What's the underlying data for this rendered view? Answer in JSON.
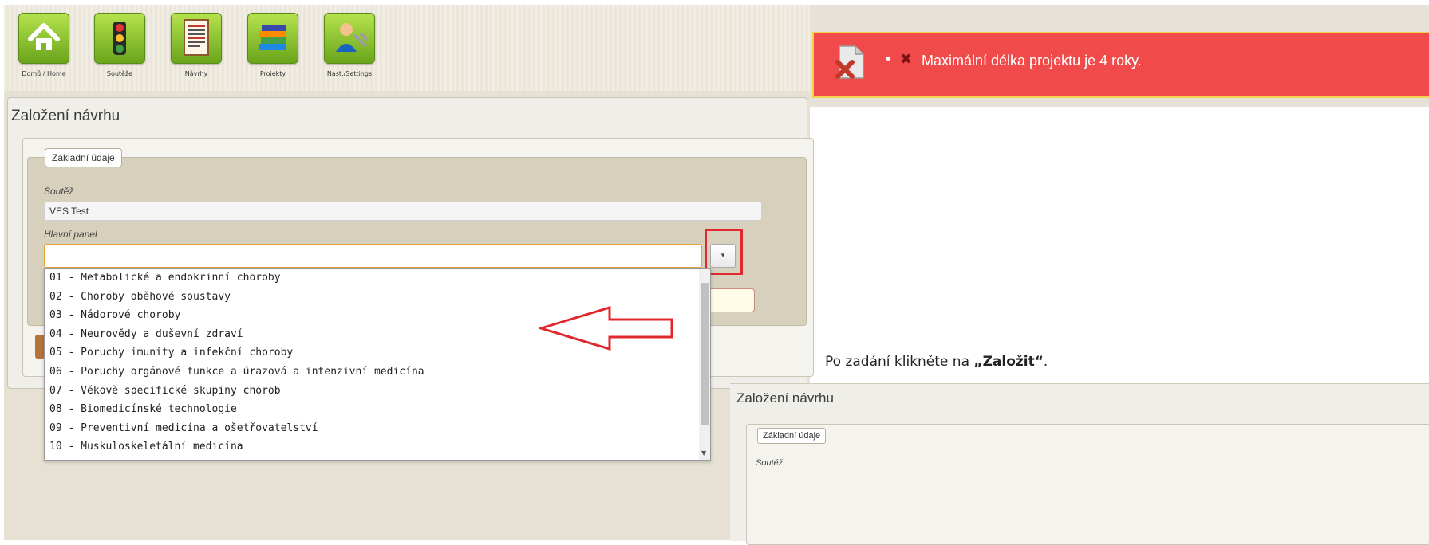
{
  "nav": {
    "items": [
      {
        "label": "Domů / Home",
        "icon": "home-icon"
      },
      {
        "label": "Soutěže",
        "icon": "traffic-light-icon"
      },
      {
        "label": "Návrhy",
        "icon": "document-icon"
      },
      {
        "label": "Projekty",
        "icon": "books-icon"
      },
      {
        "label": "Nast./Settings",
        "icon": "user-wrench-icon"
      }
    ]
  },
  "form": {
    "title": "Založení návrhu",
    "legend": "Základní údaje",
    "competition_label": "Soutěž",
    "competition_value": "VES Test",
    "panel_label": "Hlavní panel",
    "panel_value": ""
  },
  "dropdown": {
    "options": [
      "01 - Metabolické a endokrinní choroby",
      "02 - Choroby oběhové soustavy",
      "03 - Nádorové choroby",
      "04 - Neurovědy a duševní zdraví",
      "05 - Poruchy imunity a infekční choroby",
      "06 - Poruchy orgánové funkce a úrazová a intenzivní medicína",
      "07 - Věkově specifické skupiny chorob",
      "08 - Biomedicínské technologie",
      "09 - Preventivní medicína a ošetřovatelství",
      "10 - Muskuloskeletální medicína"
    ]
  },
  "error_banner": {
    "bullet": "•",
    "message": "Maximální délka projektu je 4 roky.",
    "color": "#f04a4a"
  },
  "instruction": {
    "prefix": "Po zadání klikněte na ",
    "bold": "„Založit“",
    "suffix": "."
  },
  "second_form": {
    "title": "Založení návrhu",
    "legend": "Základní údaje",
    "competition_label": "Soutěž"
  },
  "colors": {
    "accent_red": "#e0282e",
    "nav_green": "#8cc63f"
  }
}
